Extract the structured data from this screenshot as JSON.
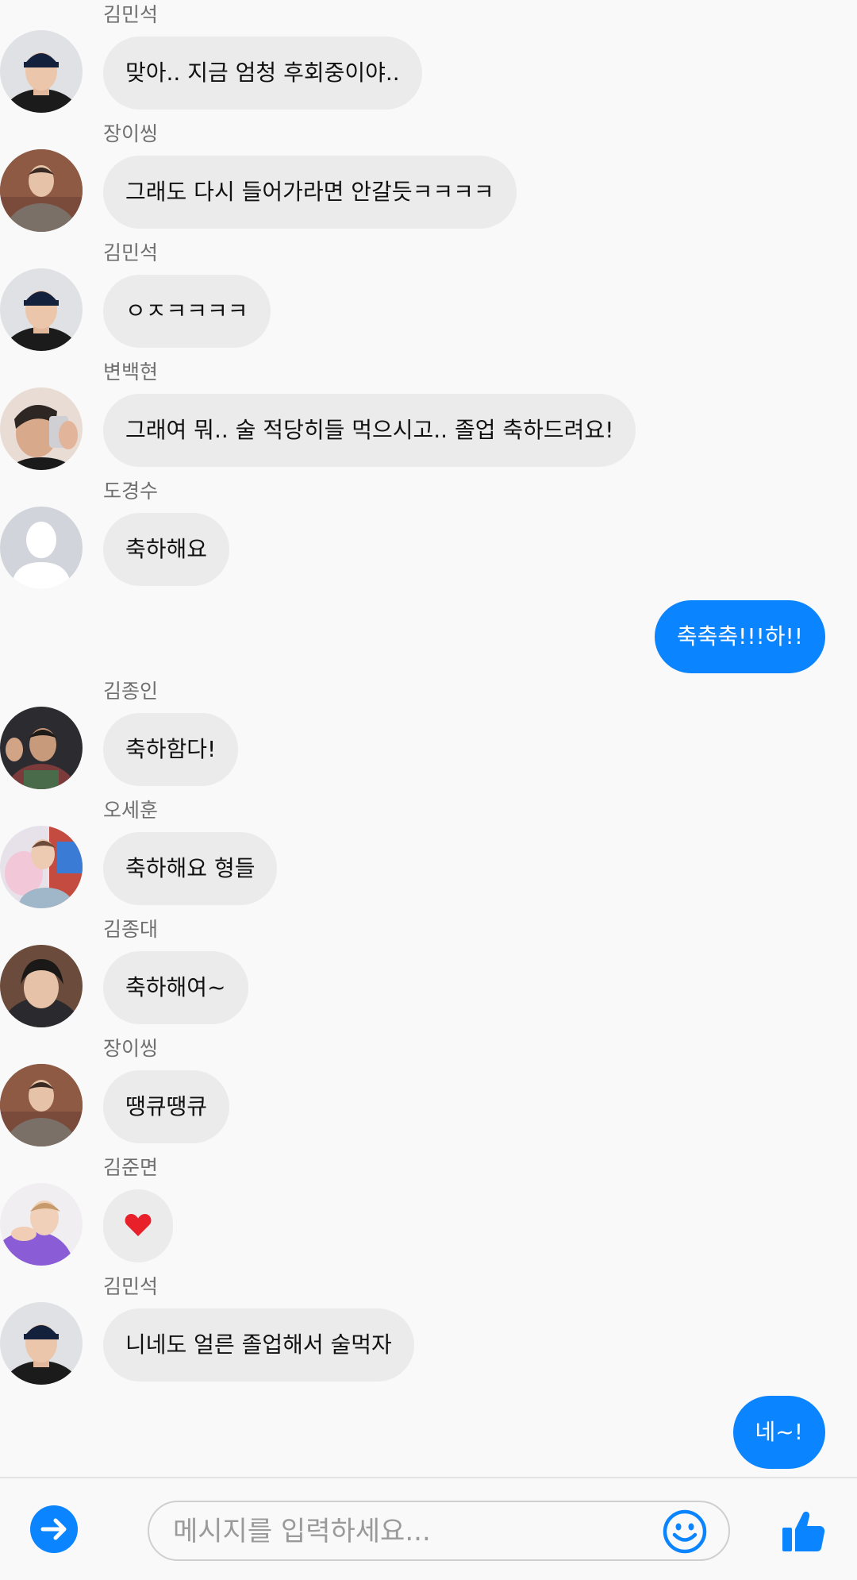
{
  "messages": [
    {
      "sender": "김민석",
      "text": "맞아.. 지금 엄청 후회중이야..",
      "avatar": "avatar-cap-black"
    },
    {
      "sender": "장이씽",
      "text": "그래도 다시 들어가라면 안갈듯ㅋㅋㅋㅋ",
      "avatar": "avatar-plaid-coat"
    },
    {
      "sender": "김민석",
      "text": "ㅇㅈㅋㅋㅋㅋ",
      "avatar": "avatar-cap-black"
    },
    {
      "sender": "변백현",
      "text": "그래여 뭐.. 술 적당히들 먹으시고.. 졸업 축하드려요!",
      "avatar": "avatar-phone-selfie"
    },
    {
      "sender": "도경수",
      "text": "축하해요",
      "avatar": "avatar-default-silhouette"
    },
    {
      "mine": true,
      "text": "축축축!!!하!!"
    },
    {
      "sender": "김종인",
      "text": "축하함다!",
      "avatar": "avatar-waving"
    },
    {
      "sender": "오세훈",
      "text": "축하해요 형들",
      "avatar": "avatar-cotton-candy"
    },
    {
      "sender": "김종대",
      "text": "축하해여~",
      "avatar": "avatar-dark-hood"
    },
    {
      "sender": "장이씽",
      "text": "땡큐땡큐",
      "avatar": "avatar-plaid-coat"
    },
    {
      "sender": "김준면",
      "text": "",
      "emoji": "heart-icon",
      "avatar": "avatar-purple-sweater"
    },
    {
      "sender": "김민석",
      "text": "니네도 얼른 졸업해서 술먹자",
      "avatar": "avatar-cap-black"
    },
    {
      "mine": true,
      "text": "네~!"
    }
  ],
  "composer": {
    "placeholder": "메시지를 입력하세요...",
    "send_icon": "arrow-right-circle-icon",
    "emoji_icon": "smiley-icon",
    "like_icon": "thumbs-up-icon"
  },
  "colors": {
    "accent": "#0a84ff",
    "incoming_bubble": "#ebebeb",
    "background": "#f9f9f9",
    "heart": "#e8202a"
  }
}
